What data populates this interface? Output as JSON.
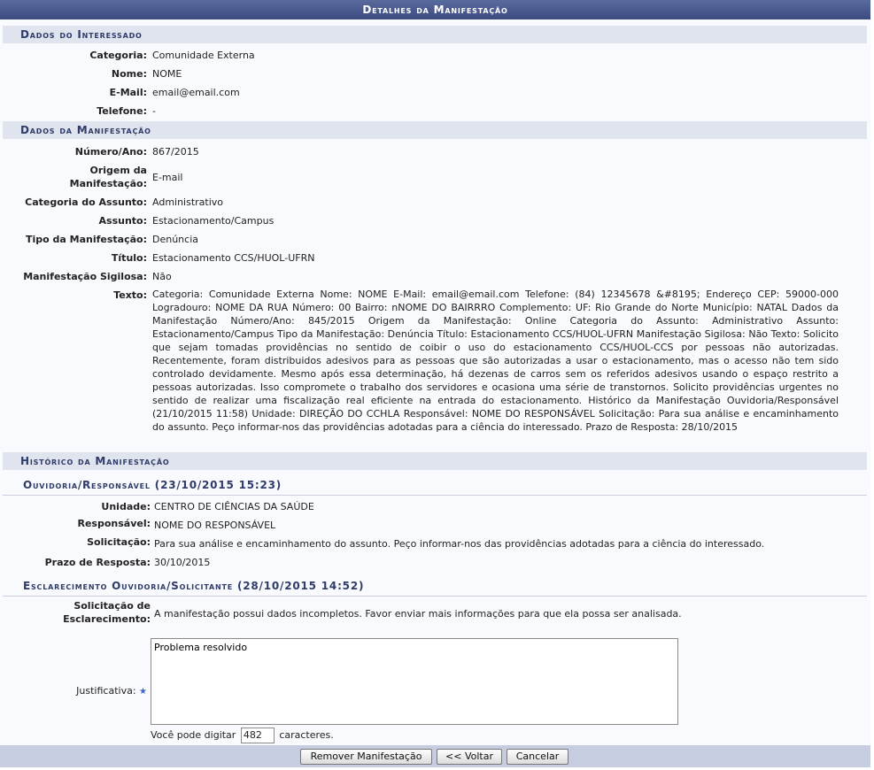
{
  "window": {
    "title": "Detalhes da Manifestação"
  },
  "interessado": {
    "heading": "Dados do Interessado",
    "categoria_label": "Categoria:",
    "categoria": "Comunidade Externa",
    "nome_label": "Nome:",
    "nome": "NOME",
    "email_label": "E-Mail:",
    "email": "email@email.com",
    "telefone_label": "Telefone:",
    "telefone": "-"
  },
  "manifestacao": {
    "heading": "Dados da Manifestação",
    "numero_label": "Número/Ano:",
    "numero": "867/2015",
    "origem_label_1": "Origem da",
    "origem_label_2": "Manifestação:",
    "origem": "E-mail",
    "categoria_assunto_label": "Categoria do Assunto:",
    "categoria_assunto": "Administrativo",
    "assunto_label": "Assunto:",
    "assunto": "Estacionamento/Campus",
    "tipo_label": "Tipo da Manifestação:",
    "tipo": "Denúncia",
    "titulo_label": "Título:",
    "titulo": "Estacionamento CCS/HUOL-UFRN",
    "sigilosa_label": "Manifestação Sigilosa:",
    "sigilosa": "Não",
    "texto_label": "Texto:",
    "texto": "Categoria: Comunidade Externa Nome: NOME E-Mail: email@email.com Telefone: (84) 12345678 &#8195; Endereço CEP: 59000-000 Logradouro: NOME DA RUA Número: 00 Bairro: nNOME DO BAIRRRO Complemento: UF: Rio Grande do Norte Município: NATAL Dados da Manifestação Número/Ano: 845/2015 Origem da Manifestação: Online Categoria do Assunto: Administrativo Assunto: Estacionamento/Campus Tipo da Manifestação: Denúncia Título: Estacionamento CCS/HUOL-UFRN Manifestação Sigilosa: Não Texto: Solicito que sejam tomadas providências no sentido de coibir o uso do estacionamento CCS/HUOL-CCS por pessoas não autorizadas. Recentemente, foram distribuidos adesivos para as pessoas que são autorizadas a usar o estacionamento, mas o acesso não tem sido controlado devidamente. Mesmo após essa determinação, há dezenas de carros sem os referidos adesivos usando o espaço restrito a pessoas autorizadas. Isso compromete o trabalho dos servidores e ocasiona uma série de transtornos. Solicito providências urgentes no sentido de realizar uma fiscalização real eficiente na entrada do estacionamento. Histórico da Manifestação Ouvidoria/Responsável (21/10/2015 11:58) Unidade: DIREÇÃO DO CCHLA Responsável: NOME DO RESPONSÁVEL Solicitação: Para sua análise e encaminhamento do assunto. Peço informar-nos das providências adotadas para a ciência do interessado. Prazo de Resposta: 28/10/2015"
  },
  "historico": {
    "heading": "Histórico da Manifestação",
    "ouvidoria_heading": "Ouvidoria/Responsável (23/10/2015 15:23)",
    "unidade_label": "Unidade:",
    "unidade": "CENTRO DE CIÊNCIAS DA SAÚDE",
    "responsavel_label": "Responsável:",
    "responsavel": "NOME DO RESPONSÁVEL",
    "solicitacao_label": "Solicitação:",
    "solicitacao": "Para sua análise e encaminhamento do assunto. Peço informar-nos das providências adotadas para a ciência do interessado.",
    "prazo_label": "Prazo de Resposta:",
    "prazo": "30/10/2015",
    "esclarecimento_heading": "Esclarecimento Ouvidoria/Solicitante (28/10/2015 14:52)",
    "solic_esclarecimento_label_1": "Solicitação de",
    "solic_esclarecimento_label_2": "Esclarecimento:",
    "solic_esclarecimento": "A manifestação possui dados incompletos. Favor enviar mais informações para que ela possa ser analisada."
  },
  "form": {
    "justificativa_label": "Justificativa:",
    "required_mark": "★",
    "justificativa_value": "Problema resolvido",
    "counter_prefix": "Você pode digitar",
    "counter_value": "482",
    "counter_suffix": "caracteres."
  },
  "buttons": {
    "remover": "Remover Manifestação",
    "voltar": "<< Voltar",
    "cancelar": "Cancelar"
  },
  "colors": {
    "title_bar": "#3b4a7f",
    "section_bg": "#dfe4ef",
    "footer_bg": "#c6cde0",
    "required_star": "#3a66c6"
  }
}
